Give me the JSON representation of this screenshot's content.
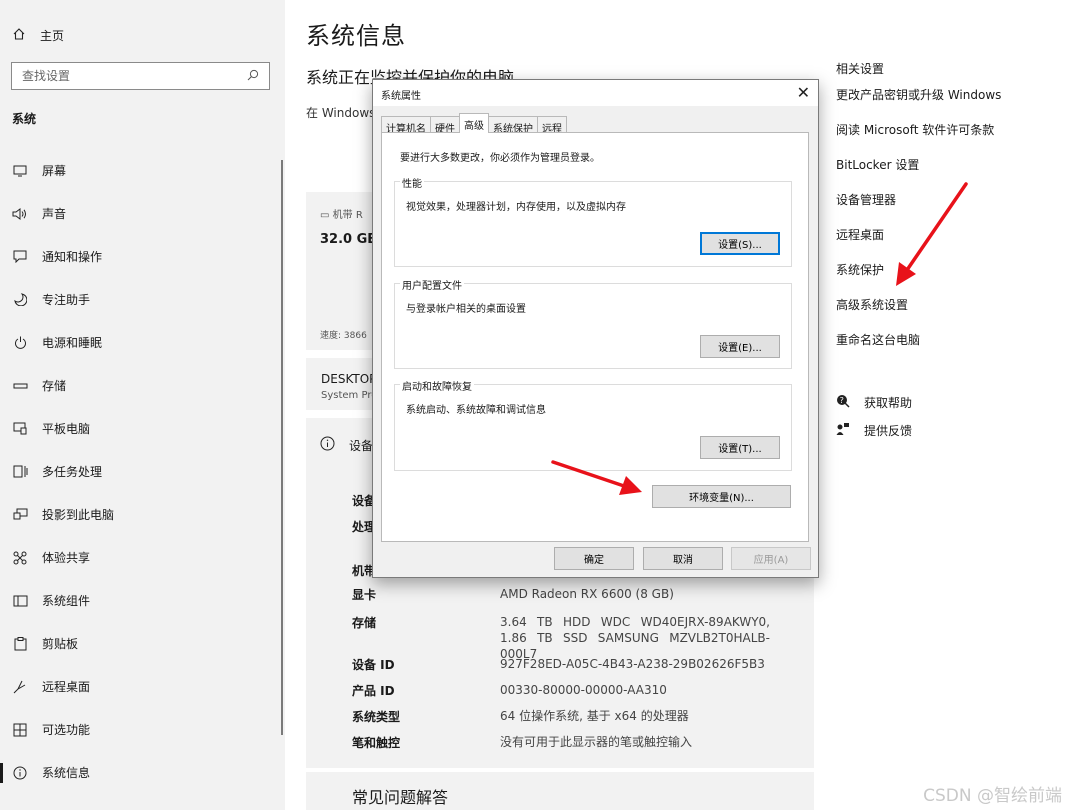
{
  "sidebar": {
    "home_label": "主页",
    "search_placeholder": "查找设置",
    "section": "系统",
    "items": [
      {
        "label": "屏幕",
        "icon": "monitor-icon"
      },
      {
        "label": "声音",
        "icon": "speaker-icon"
      },
      {
        "label": "通知和操作",
        "icon": "notification-icon"
      },
      {
        "label": "专注助手",
        "icon": "moon-icon"
      },
      {
        "label": "电源和睡眠",
        "icon": "power-icon"
      },
      {
        "label": "存储",
        "icon": "storage-icon"
      },
      {
        "label": "平板电脑",
        "icon": "tablet-icon"
      },
      {
        "label": "多任务处理",
        "icon": "multitask-icon"
      },
      {
        "label": "投影到此电脑",
        "icon": "projection-icon"
      },
      {
        "label": "体验共享",
        "icon": "share-icon"
      },
      {
        "label": "系统组件",
        "icon": "components-icon"
      },
      {
        "label": "剪贴板",
        "icon": "clipboard-icon"
      },
      {
        "label": "远程桌面",
        "icon": "remote-icon"
      },
      {
        "label": "可选功能",
        "icon": "optional-features-icon"
      },
      {
        "label": "系统信息",
        "icon": "info-icon"
      }
    ]
  },
  "main": {
    "title": "系统信息",
    "subtitle": "系统正在监控并保护你的电脑。",
    "windows_text": "在 Windows",
    "device_card": {
      "label": "机带 R",
      "memory": "32.0 GB",
      "speed": "速度: 3866"
    },
    "name_card": {
      "name": "DESKTOP",
      "sub": "System Pro"
    },
    "spec_header": "设备",
    "spec_partial": [
      "设备",
      "处理",
      "机带"
    ],
    "specs": [
      {
        "key": "显卡",
        "value": "AMD Radeon RX 6600 (8 GB)"
      },
      {
        "key": "存储",
        "value": "3.64 TB HDD WDC WD40EJRX-89AKWY0, 1.86 TB SSD SAMSUNG MZVLB2T0HALB-000L7"
      },
      {
        "key": "设备 ID",
        "value": "927F28ED-A05C-4B43-A238-29B02626F5B3"
      },
      {
        "key": "产品 ID",
        "value": "00330-80000-00000-AA310"
      },
      {
        "key": "系统类型",
        "value": "64 位操作系统, 基于 x64 的处理器"
      },
      {
        "key": "笔和触控",
        "value": "没有可用于此显示器的笔或触控输入"
      }
    ],
    "faq": "常见问题解答"
  },
  "related": {
    "heading": "相关设置",
    "links": [
      "更改产品密钥或升级 Windows",
      "阅读 Microsoft 软件许可条款",
      "BitLocker 设置",
      "设备管理器",
      "远程桌面",
      "系统保护",
      "高级系统设置",
      "重命名这台电脑"
    ],
    "help": "获取帮助",
    "feedback": "提供反馈"
  },
  "dialog": {
    "title": "系统属性",
    "tabs": [
      "计算机名",
      "硬件",
      "高级",
      "系统保护",
      "远程"
    ],
    "active_tab": "高级",
    "admin_note": "要进行大多数更改，你必须作为管理员登录。",
    "groups": [
      {
        "title": "性能",
        "desc": "视觉效果，处理器计划，内存使用，以及虚拟内存",
        "button": "设置(S)..."
      },
      {
        "title": "用户配置文件",
        "desc": "与登录帐户相关的桌面设置",
        "button": "设置(E)..."
      },
      {
        "title": "启动和故障恢复",
        "desc": "系统启动、系统故障和调试信息",
        "button": "设置(T)..."
      }
    ],
    "env_button": "环境变量(N)...",
    "ok": "确定",
    "cancel": "取消",
    "apply": "应用(A)"
  },
  "watermark": "CSDN @智绘前端",
  "colors": {
    "arrow": "#e8121a",
    "focus": "#0078d7"
  }
}
